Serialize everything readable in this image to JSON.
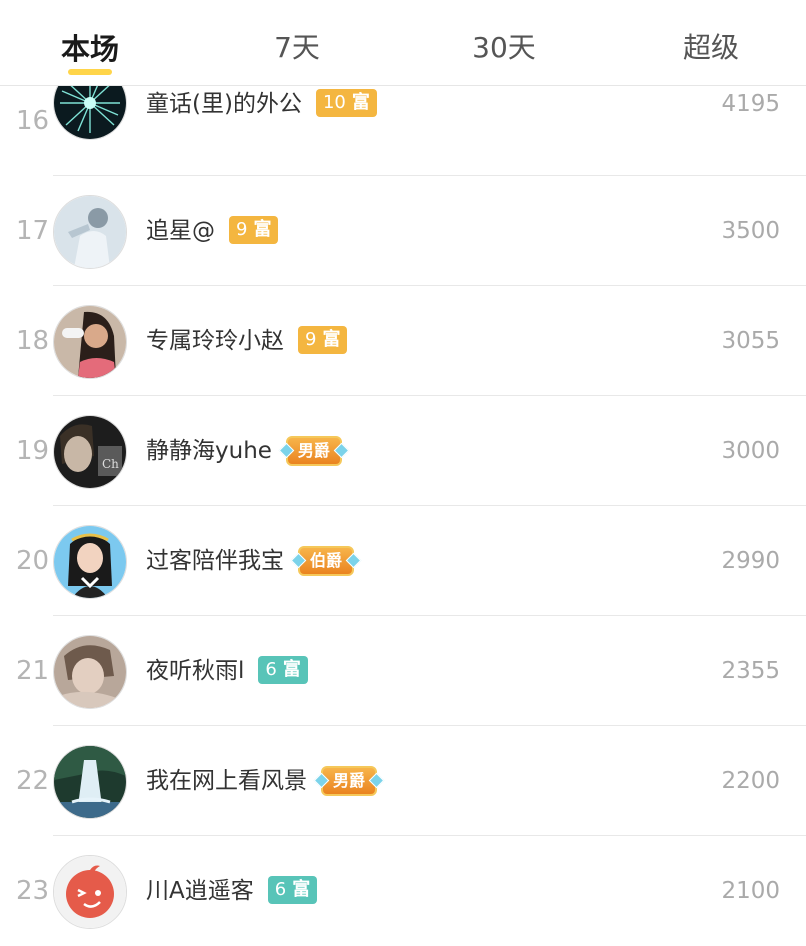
{
  "tabs": [
    {
      "label": "本场",
      "active": true
    },
    {
      "label": "7天",
      "active": false
    },
    {
      "label": "30天",
      "active": false
    },
    {
      "label": "超级",
      "active": false
    }
  ],
  "colors": {
    "tab_indicator": "#ffd54a",
    "badge_gold": "#f4b640",
    "badge_teal": "#58c4b8",
    "noble_orange": "#ea8320"
  },
  "rows": [
    {
      "rank": "16",
      "name": "童话(里)的外公",
      "badge_type": "level",
      "badge_level": "10",
      "badge_text": "富",
      "badge_color": "gold",
      "score": "4195",
      "avatar": "fireworks-avatar"
    },
    {
      "rank": "17",
      "name": "追星@",
      "badge_type": "level",
      "badge_level": "9",
      "badge_text": "富",
      "badge_color": "gold",
      "score": "3500",
      "avatar": "person-avatar"
    },
    {
      "rank": "18",
      "name": "专属玲玲小赵",
      "badge_type": "level",
      "badge_level": "9",
      "badge_text": "富",
      "badge_color": "gold",
      "score": "3055",
      "avatar": "girl-drinking-avatar"
    },
    {
      "rank": "19",
      "name": "静静海yuhe",
      "badge_type": "noble",
      "badge_text": "男爵",
      "score": "3000",
      "avatar": "boy-portrait-avatar"
    },
    {
      "rank": "20",
      "name": "过客陪伴我宝",
      "badge_type": "noble",
      "badge_text": "伯爵",
      "score": "2990",
      "avatar": "girl-headband-avatar"
    },
    {
      "rank": "21",
      "name": "夜听秋雨l",
      "badge_type": "level",
      "badge_level": "6",
      "badge_text": "富",
      "badge_color": "teal",
      "score": "2355",
      "avatar": "sepia-portrait-avatar"
    },
    {
      "rank": "22",
      "name": "我在网上看风景",
      "badge_type": "noble",
      "badge_text": "男爵",
      "score": "2200",
      "avatar": "waterfall-avatar"
    },
    {
      "rank": "23",
      "name": "川A逍遥客",
      "badge_type": "level",
      "badge_level": "6",
      "badge_text": "富",
      "badge_color": "teal",
      "score": "2100",
      "avatar": "wink-face-avatar"
    }
  ]
}
